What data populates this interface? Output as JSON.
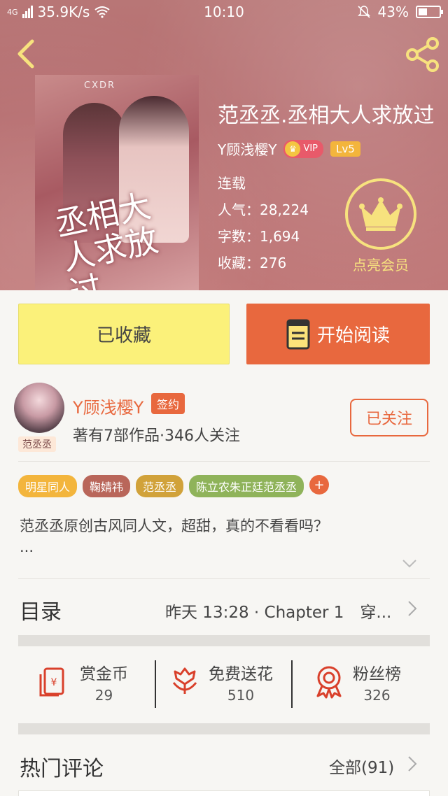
{
  "status_bar": {
    "network": "4G",
    "speed": "35.9K/s",
    "time": "10:10",
    "battery": "43%",
    "battery_level": 0.43
  },
  "book": {
    "title": "范丞丞.丞相大人求放过",
    "cover_title": "丞相大人求放过",
    "cover_tag": "CXDR",
    "author": "Y顾浅樱Y",
    "vip_label": "VIP",
    "level": "Lv5",
    "status": "连载",
    "popularity": "人气：28,224",
    "word_count": "字数：1,694",
    "favorites": "收藏：276"
  },
  "member": {
    "label": "点亮会员"
  },
  "actions": {
    "collect_label": "已收藏",
    "read_label": "开始阅读"
  },
  "author": {
    "name": "Y顾浅樱Y",
    "avatar_tag": "范丞丞",
    "sign_label": "签约",
    "stats": "著有7部作品·346人关注",
    "follow_label": "已关注"
  },
  "tags": [
    {
      "label": "明星同人",
      "color": "#f3b53c"
    },
    {
      "label": "鞠婧祎",
      "color": "#b9665a"
    },
    {
      "label": "范丞丞",
      "color": "#d1a23a"
    },
    {
      "label": "陈立农朱正廷范丞丞",
      "color": "#8fb35a"
    }
  ],
  "tag_add": "+",
  "intro": {
    "text": "范丞丞原创古风同人文，超甜，真的不看看吗？",
    "ellipsis": "..."
  },
  "toc": {
    "title": "目录",
    "latest": "昨天 13:28 · Chapter 1　穿..."
  },
  "stats": [
    {
      "label": "赏金币",
      "value": "29",
      "icon": "red-envelope-icon"
    },
    {
      "label": "免费送花",
      "value": "510",
      "icon": "flower-icon"
    },
    {
      "label": "粉丝榜",
      "value": "326",
      "icon": "medal-icon"
    }
  ],
  "comments": {
    "title": "热门评论",
    "all_label": "全部(91)"
  },
  "colors": {
    "accent": "#e8683e",
    "collect_bg": "#fbf17a",
    "member_gold": "#f7e27e"
  }
}
